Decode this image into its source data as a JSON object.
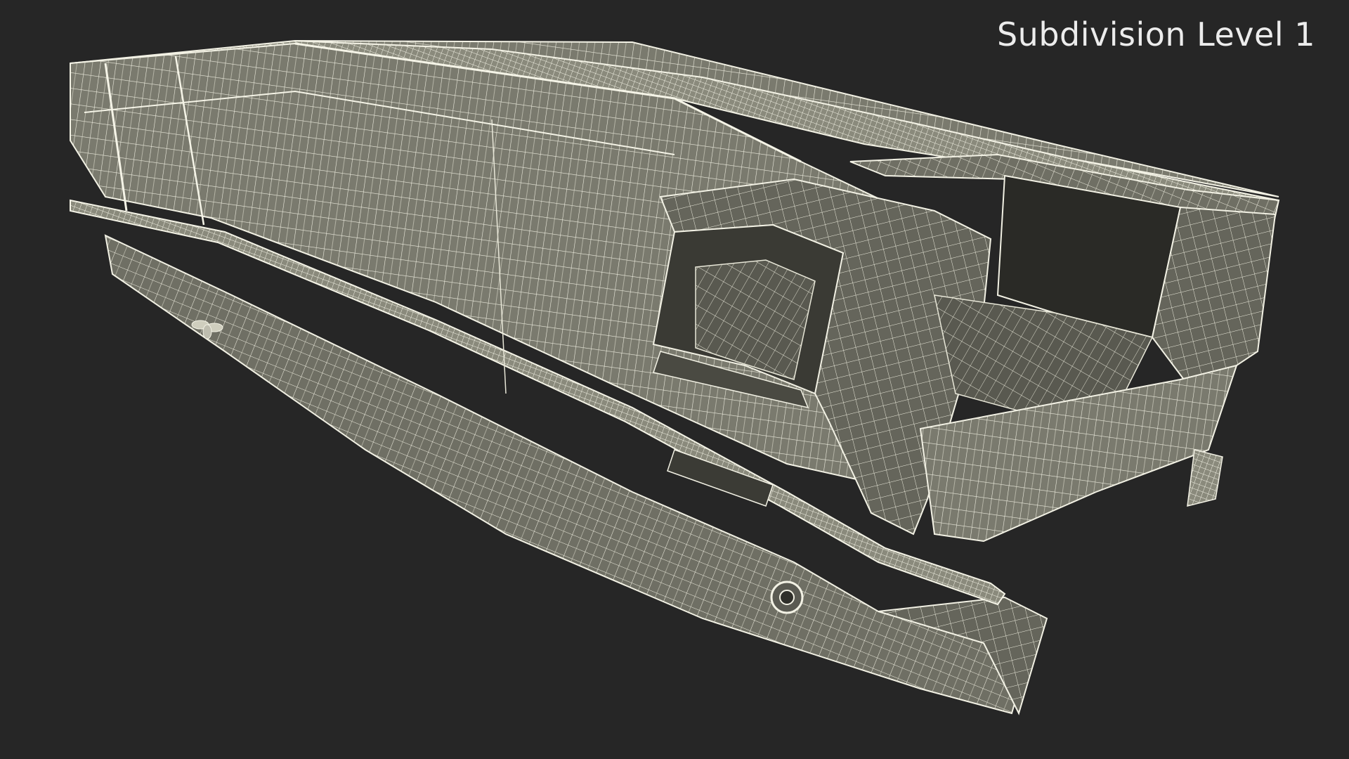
{
  "viewport": {
    "background_color": "#262626",
    "overlay_label": "Subdivision Level 1",
    "label_color": "#ececec"
  },
  "model": {
    "render_style": "wireframe-over-shaded",
    "surface_color": "#7a7a6e",
    "wire_color": "#f2f1e4"
  }
}
